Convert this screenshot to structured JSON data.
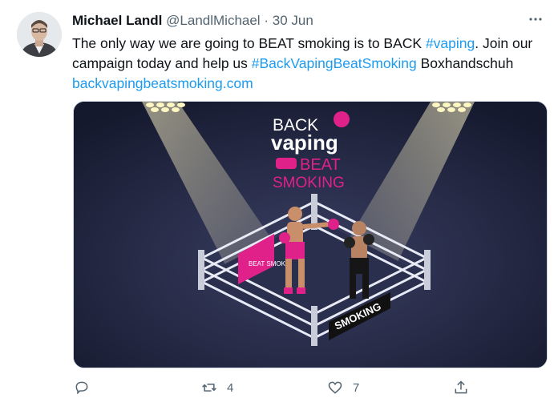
{
  "tweet": {
    "author_name": "Michael Landl",
    "author_handle": "@LandlMichael",
    "separator": "·",
    "date": "30 Jun",
    "text": {
      "part1": "The only way we are going to BEAT smoking is to BACK ",
      "hashtag1": "#vaping",
      "part2": ". Join our campaign today and help us ",
      "hashtag2": "#BackVapingBeatSmoking",
      "part3": " Boxhandschuh ",
      "link": "backvapingbeatsmoking.com"
    }
  },
  "media": {
    "logo_back": "BACK",
    "logo_vaping": "vaping",
    "logo_beat": "BEAT",
    "logo_smoking": "SMOKING",
    "banner_text": "SMOKING",
    "corner_sign": "BEAT SMOK"
  },
  "actions": {
    "retweet_count": "4",
    "like_count": "7"
  },
  "colors": {
    "link": "#1d9bf0",
    "magenta": "#e0218a",
    "navy_bg": "#1a1f3a"
  }
}
